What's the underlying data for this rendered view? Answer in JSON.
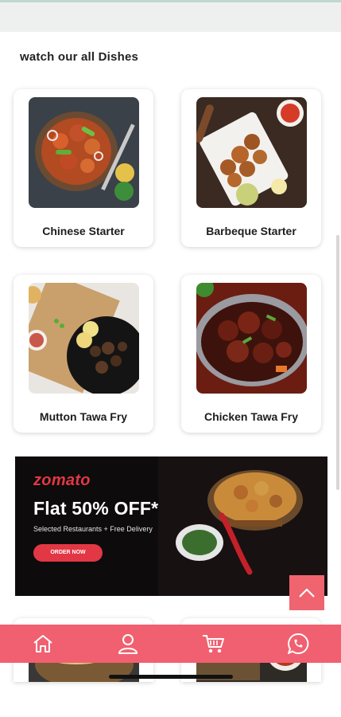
{
  "section": {
    "title": "watch our all Dishes"
  },
  "dishes": [
    {
      "label": "Chinese Starter",
      "image": "chinese-starter-photo"
    },
    {
      "label": "Barbeque Starter",
      "image": "barbeque-starter-photo"
    },
    {
      "label": "Mutton Tawa Fry",
      "image": "mutton-tawa-fry-photo"
    },
    {
      "label": "Chicken Tawa Fry",
      "image": "chicken-tawa-fry-photo"
    }
  ],
  "banner": {
    "brand": "zomato",
    "headline": "Flat 50% OFF*",
    "subtext": "Selected Restaurants + Free Delivery",
    "cta": "ORDER NOW"
  },
  "bottom_nav": [
    {
      "icon": "home-icon"
    },
    {
      "icon": "user-icon"
    },
    {
      "icon": "cart-icon"
    },
    {
      "icon": "whatsapp-icon"
    }
  ],
  "colors": {
    "accent": "#f06070",
    "brand": "#e23744",
    "banner_bg": "#0d0b0b"
  }
}
